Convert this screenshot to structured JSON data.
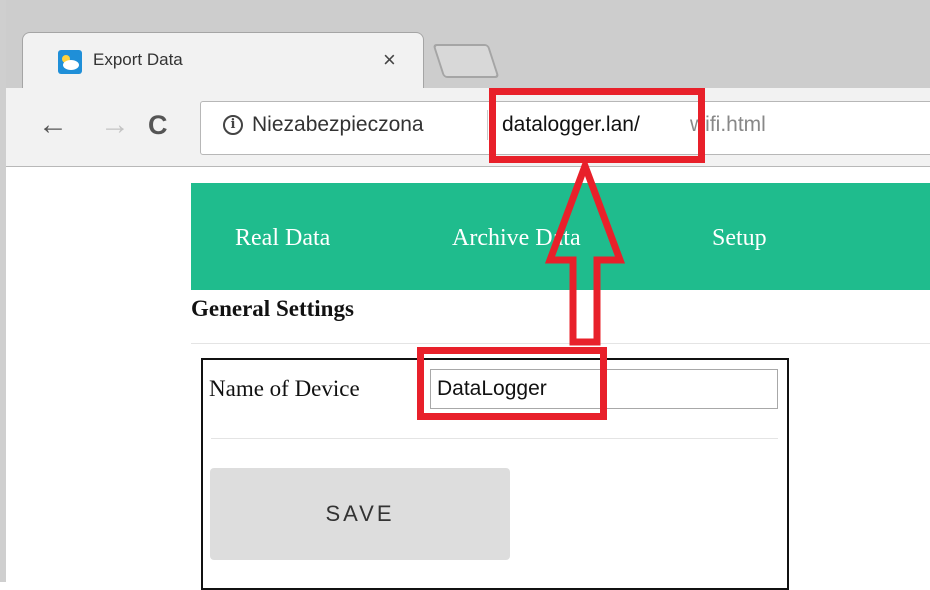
{
  "browser": {
    "tab": {
      "title": "Export Data",
      "close_glyph": "×",
      "icon": "cloud-sun-icon"
    },
    "toolbar": {
      "back_glyph": "←",
      "forward_glyph": "→",
      "reload_glyph": "C"
    },
    "omnibox": {
      "info_glyph": "i",
      "security_label": "Niezabezpieczona",
      "url_host": "datalogger.lan/",
      "url_path": "wifi.html"
    }
  },
  "page": {
    "nav": [
      {
        "label": "Real Data"
      },
      {
        "label": "Archive Data"
      },
      {
        "label": "Setup"
      }
    ],
    "section_title": "General Settings",
    "form": {
      "device_name_label": "Name of Device",
      "device_name_value": "DataLogger",
      "save_label": "SAVE"
    }
  },
  "colors": {
    "accent": "#1fbc8d",
    "annotation": "#e8202a"
  }
}
